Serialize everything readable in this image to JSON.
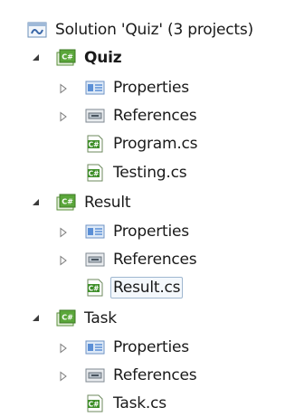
{
  "tree": {
    "solution": {
      "label": "Solution 'Quiz' (3 projects)"
    },
    "projects": [
      {
        "label": "Quiz",
        "bold": true,
        "items": [
          {
            "label": "Properties",
            "icon": "properties-folder-icon",
            "expandable": true
          },
          {
            "label": "References",
            "icon": "references-folder-icon",
            "expandable": true
          },
          {
            "label": "Program.cs",
            "icon": "csharp-file-icon",
            "expandable": false
          },
          {
            "label": "Testing.cs",
            "icon": "csharp-file-icon",
            "expandable": false
          }
        ]
      },
      {
        "label": "Result",
        "bold": false,
        "items": [
          {
            "label": "Properties",
            "icon": "properties-folder-icon",
            "expandable": true
          },
          {
            "label": "References",
            "icon": "references-folder-icon",
            "expandable": true
          },
          {
            "label": "Result.cs",
            "icon": "csharp-file-icon",
            "expandable": false,
            "selected": true
          }
        ]
      },
      {
        "label": "Task",
        "bold": false,
        "items": [
          {
            "label": "Properties",
            "icon": "properties-folder-icon",
            "expandable": true
          },
          {
            "label": "References",
            "icon": "references-folder-icon",
            "expandable": true
          },
          {
            "label": "Task.cs",
            "icon": "csharp-file-icon",
            "expandable": false
          }
        ]
      }
    ]
  },
  "colors": {
    "project_icon_green": "#5aa63a",
    "csharp_icon_green": "#3f8f2a",
    "properties_blue": "#5b8fd6",
    "selection_border": "#9fb7d0"
  }
}
